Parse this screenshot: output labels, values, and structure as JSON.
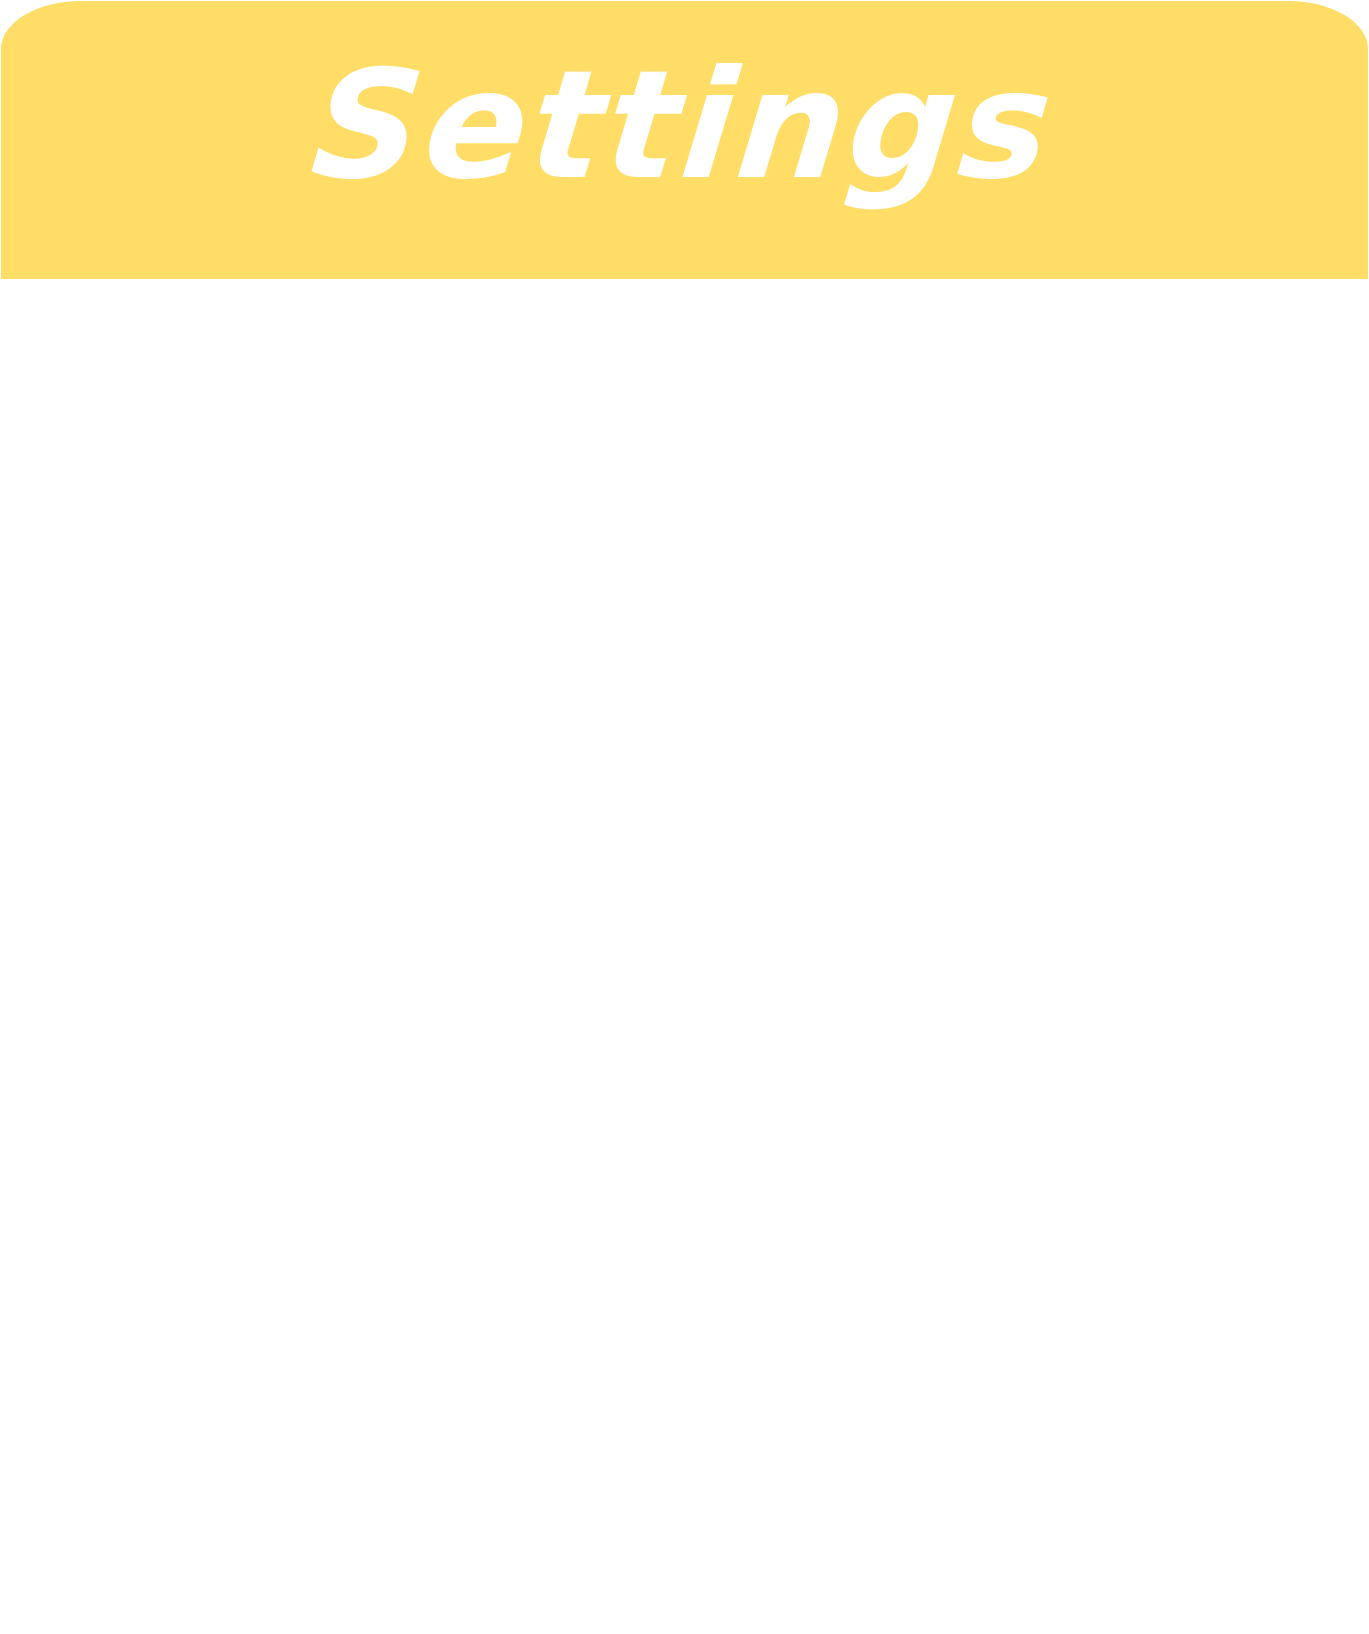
{
  "header": {
    "title": "Settings",
    "background_color": "#FFDD66",
    "title_color": "#FFFFFF"
  }
}
